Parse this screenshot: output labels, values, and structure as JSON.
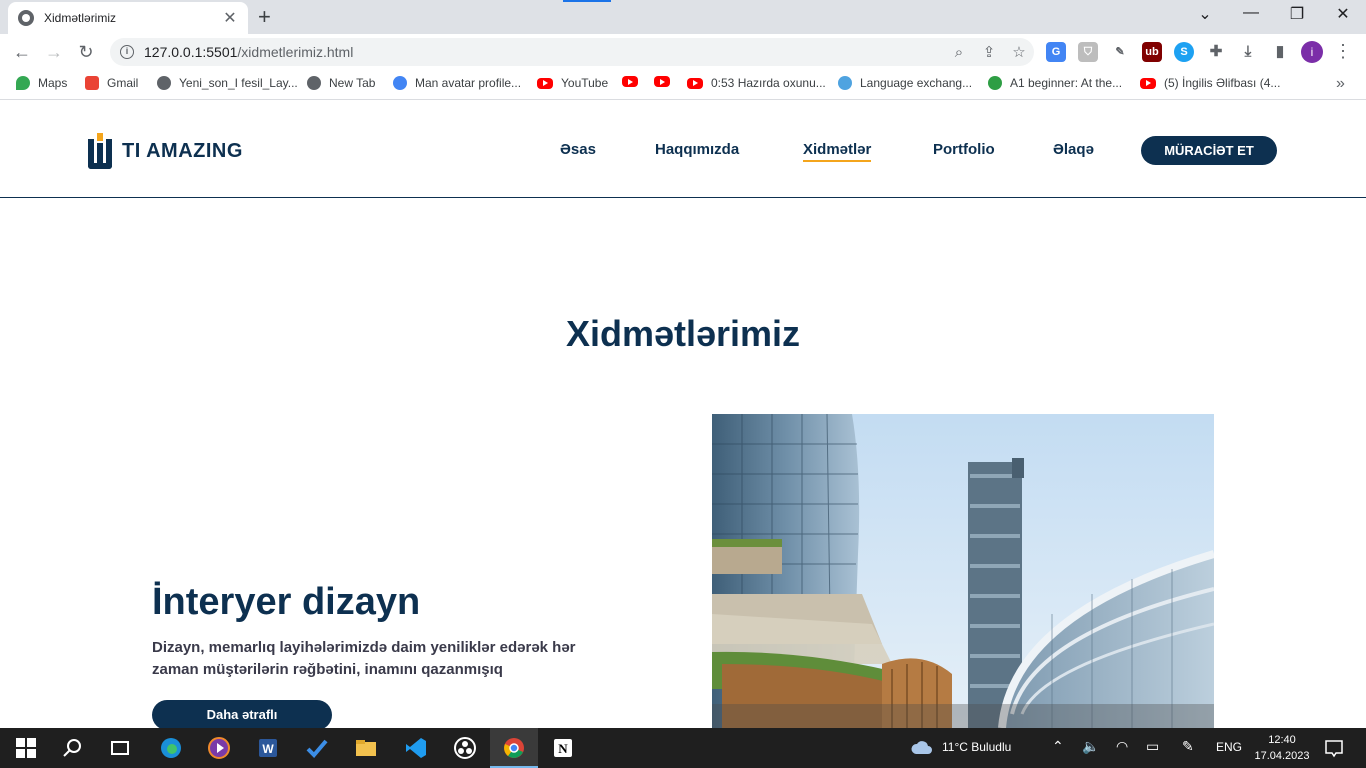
{
  "browser": {
    "tab_title": "Xidmətlərimiz",
    "url_host": "127.0.0.1:5501",
    "url_path": "/xidmetlerimiz.html",
    "profile_initial": "i",
    "bookmarks": [
      {
        "label": "Maps",
        "icon": "maps-icon"
      },
      {
        "label": "Gmail",
        "icon": "gmail-icon"
      },
      {
        "label": "Yeni_son_I fesil_Lay...",
        "icon": "globe-icon"
      },
      {
        "label": "New Tab",
        "icon": "globe-icon"
      },
      {
        "label": "Man avatar profile...",
        "icon": "google-icon"
      },
      {
        "label": "YouTube",
        "icon": "youtube-icon"
      },
      {
        "label": "",
        "icon": "youtube-icon"
      },
      {
        "label": "",
        "icon": "youtube-icon"
      },
      {
        "label": "0:53 Hazırda oxunu...",
        "icon": "youtube-icon"
      },
      {
        "label": "Language exchang...",
        "icon": "chat-icon"
      },
      {
        "label": "A1 beginner: At the...",
        "icon": "clover-icon"
      },
      {
        "label": "(5) İngilis Əlifbası (4...",
        "icon": "youtube-icon"
      }
    ]
  },
  "site": {
    "logo_text": "TI AMAZING",
    "nav": {
      "home": "Əsas",
      "about": "Haqqımızda",
      "services": "Xidmətlər",
      "portfolio": "Portfolio",
      "contact": "Əlaqə"
    },
    "cta": "MÜRACİƏT ET",
    "section_title": "Xidmətlərimiz",
    "service": {
      "title": "İnteryer dizayn",
      "description": "Dizayn, memarlıq layihələrimizdə daim yeniliklər edərək hər zaman müştərilərin rəğbətini, inamını qazanmışıq",
      "button": "Daha ətraflı"
    },
    "colors": {
      "navy": "#0d3050",
      "accent": "#f4a51c"
    }
  },
  "taskbar": {
    "weather": "11°C  Buludlu",
    "language": "ENG",
    "time": "12:40",
    "date": "17.04.2023"
  }
}
